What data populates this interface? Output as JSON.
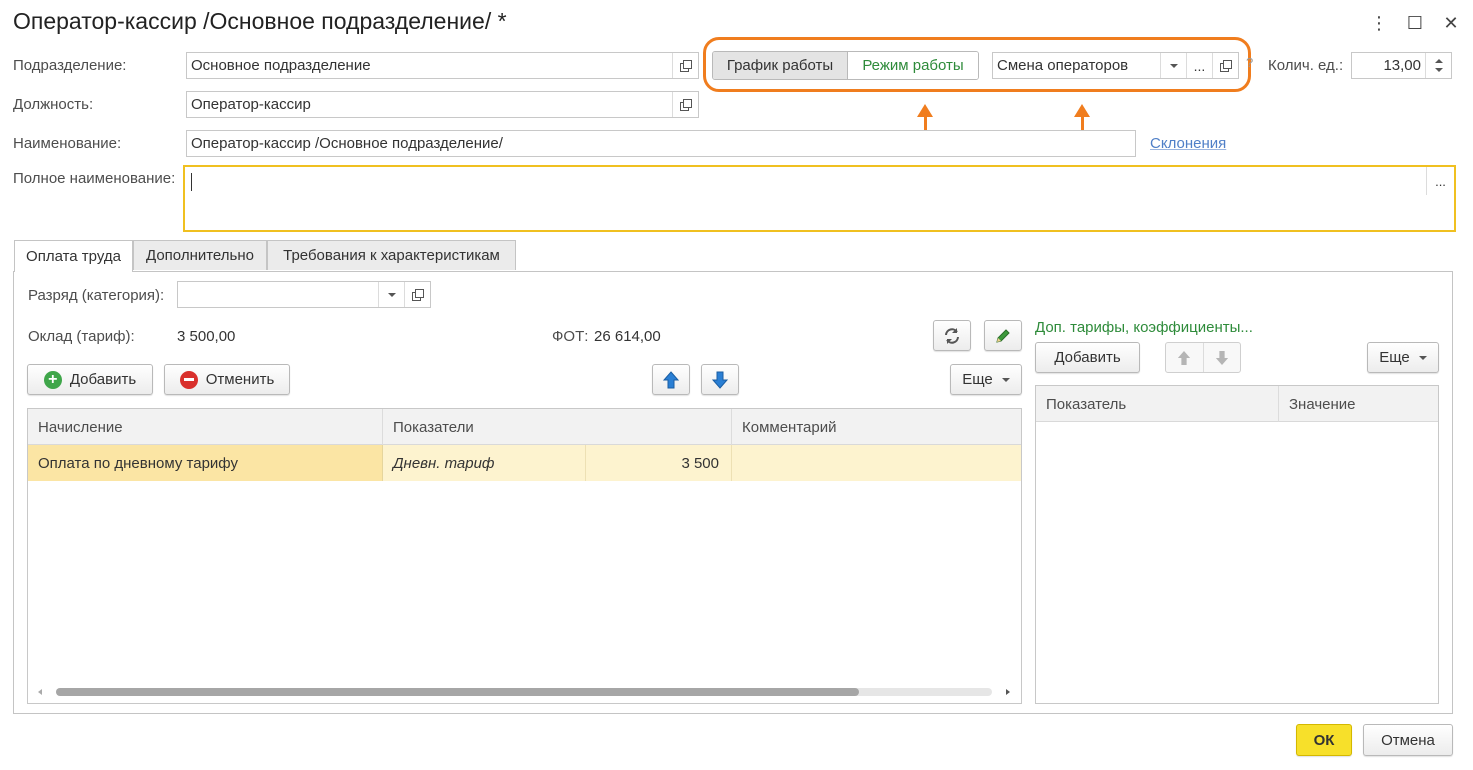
{
  "window": {
    "title": "Оператор-кассир /Основное подразделение/ *",
    "more_glyph": "⋮",
    "maximize_glyph": "☐",
    "close_glyph": "✕"
  },
  "form": {
    "subdivision_label": "Подразделение:",
    "subdivision_value": "Основное подразделение",
    "position_label": "Должность:",
    "position_value": "Оператор-кассир",
    "name_label": "Наименование:",
    "name_value": "Оператор-кассир /Основное подразделение/",
    "declensions_link": "Склонения",
    "full_name_label": "Полное наименование:",
    "full_name_value": "",
    "ellipsis": "...",
    "work_schedule_button": "График работы",
    "work_mode_button": "Режим работы",
    "shift_value": "Смена операторов",
    "help_mark": "?",
    "units_label": "Колич. ед.:",
    "units_value": "13,00"
  },
  "tabs": [
    {
      "label": "Оплата труда",
      "active": true
    },
    {
      "label": "Дополнительно",
      "active": false
    },
    {
      "label": "Требования к характеристикам",
      "active": false
    }
  ],
  "pay": {
    "rank_label": "Разряд (категория):",
    "rank_value": "",
    "salary_label": "Оклад (тариф):",
    "salary_value": "3 500,00",
    "fot_label": "ФОТ:",
    "fot_value": "26 614,00",
    "add_button": "Добавить",
    "cancel_button": "Отменить",
    "more_button": "Еще",
    "columns": [
      "Начисление",
      "Показатели",
      "Комментарий"
    ],
    "rows": [
      {
        "accrual": "Оплата по дневному тарифу",
        "indicator": "Дневн. тариф",
        "amount": "3 500",
        "comment": ""
      }
    ]
  },
  "extra": {
    "title": "Доп. тарифы, коэффициенты...",
    "add_button": "Добавить",
    "more_button": "Еще",
    "columns": [
      "Показатель",
      "Значение"
    ]
  },
  "footer": {
    "ok_button": "ОК",
    "cancel_button": "Отмена"
  },
  "colors": {
    "accent_orange": "#f07d1e",
    "green_text": "#2e8b3a",
    "link_blue": "#4f7fc7",
    "selected_row": "#fbe5a4",
    "ok_yellow": "#f7e02a",
    "active_field_border": "#f0c020"
  }
}
